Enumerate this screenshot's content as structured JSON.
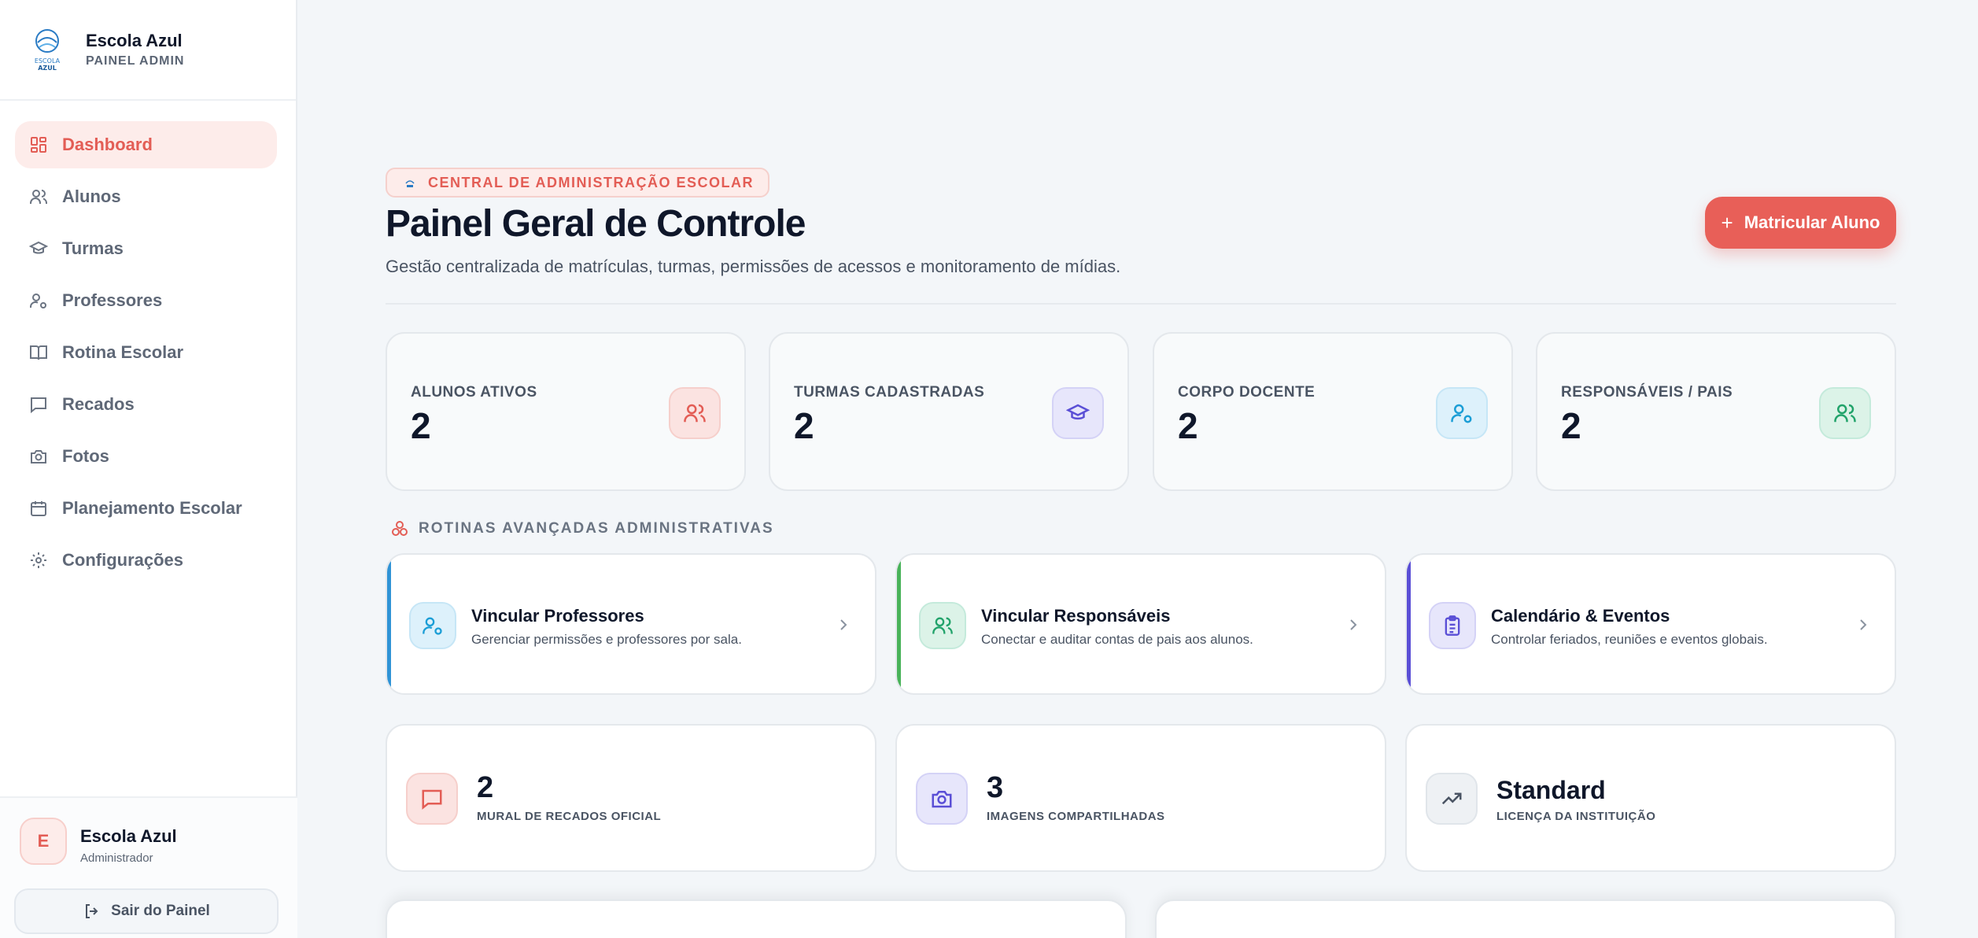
{
  "brand": {
    "name": "Escola Azul",
    "subtitle": "PAINEL ADMIN",
    "logo_text": "ESCOLA AZUL"
  },
  "nav": {
    "items": [
      {
        "label": "Dashboard",
        "icon": "dashboard-icon",
        "active": true
      },
      {
        "label": "Alunos",
        "icon": "users-icon"
      },
      {
        "label": "Turmas",
        "icon": "graduation-cap-icon"
      },
      {
        "label": "Professores",
        "icon": "user-cog-icon"
      },
      {
        "label": "Rotina Escolar",
        "icon": "book-open-icon"
      },
      {
        "label": "Recados",
        "icon": "message-square-icon"
      },
      {
        "label": "Fotos",
        "icon": "camera-icon"
      },
      {
        "label": "Planejamento Escolar",
        "icon": "calendar-icon"
      },
      {
        "label": "Configurações",
        "icon": "settings-icon"
      }
    ]
  },
  "user": {
    "initial": "E",
    "name": "Escola Azul",
    "role": "Administrador",
    "logout_label": "Sair do Painel"
  },
  "header": {
    "tag": "CENTRAL DE ADMINISTRAÇÃO ESCOLAR",
    "title": "Painel Geral de Controle",
    "description": "Gestão centralizada de matrículas, turmas, permissões de acessos e monitoramento de mídias.",
    "cta_label": "Matricular Aluno"
  },
  "stats": [
    {
      "label": "ALUNOS ATIVOS",
      "value": "2",
      "icon": "users-icon",
      "color": "#e35d55"
    },
    {
      "label": "TURMAS CADASTRADAS",
      "value": "2",
      "icon": "graduation-cap-icon",
      "color": "#5a4fd6"
    },
    {
      "label": "CORPO DOCENTE",
      "value": "2",
      "icon": "user-cog-icon",
      "color": "#1c9ed6"
    },
    {
      "label": "RESPONSÁVEIS / PAIS",
      "value": "2",
      "icon": "users-icon",
      "color": "#22a36b"
    }
  ],
  "section": {
    "title": "ROTINAS AVANÇADAS ADMINISTRATIVAS"
  },
  "links": [
    {
      "title": "Vincular Professores",
      "desc": "Gerenciar permissões e professores por sala.",
      "icon": "user-cog-icon",
      "accent": "#2f93d6"
    },
    {
      "title": "Vincular Responsáveis",
      "desc": "Conectar e auditar contas de pais aos alunos.",
      "icon": "users-icon",
      "accent": "#49b35a"
    },
    {
      "title": "Calendário & Eventos",
      "desc": "Controlar feriados, reuniões e eventos globais.",
      "icon": "clipboard-list-icon",
      "accent": "#5a4fd6"
    }
  ],
  "info": [
    {
      "value": "2",
      "label": "MURAL DE RECADOS OFICIAL",
      "icon": "message-square-icon"
    },
    {
      "value": "3",
      "label": "IMAGENS COMPARTILHADAS",
      "icon": "camera-icon"
    },
    {
      "value": "Standard",
      "label": "LICENÇA DA INSTITUIÇÃO",
      "icon": "trending-up-icon"
    }
  ]
}
